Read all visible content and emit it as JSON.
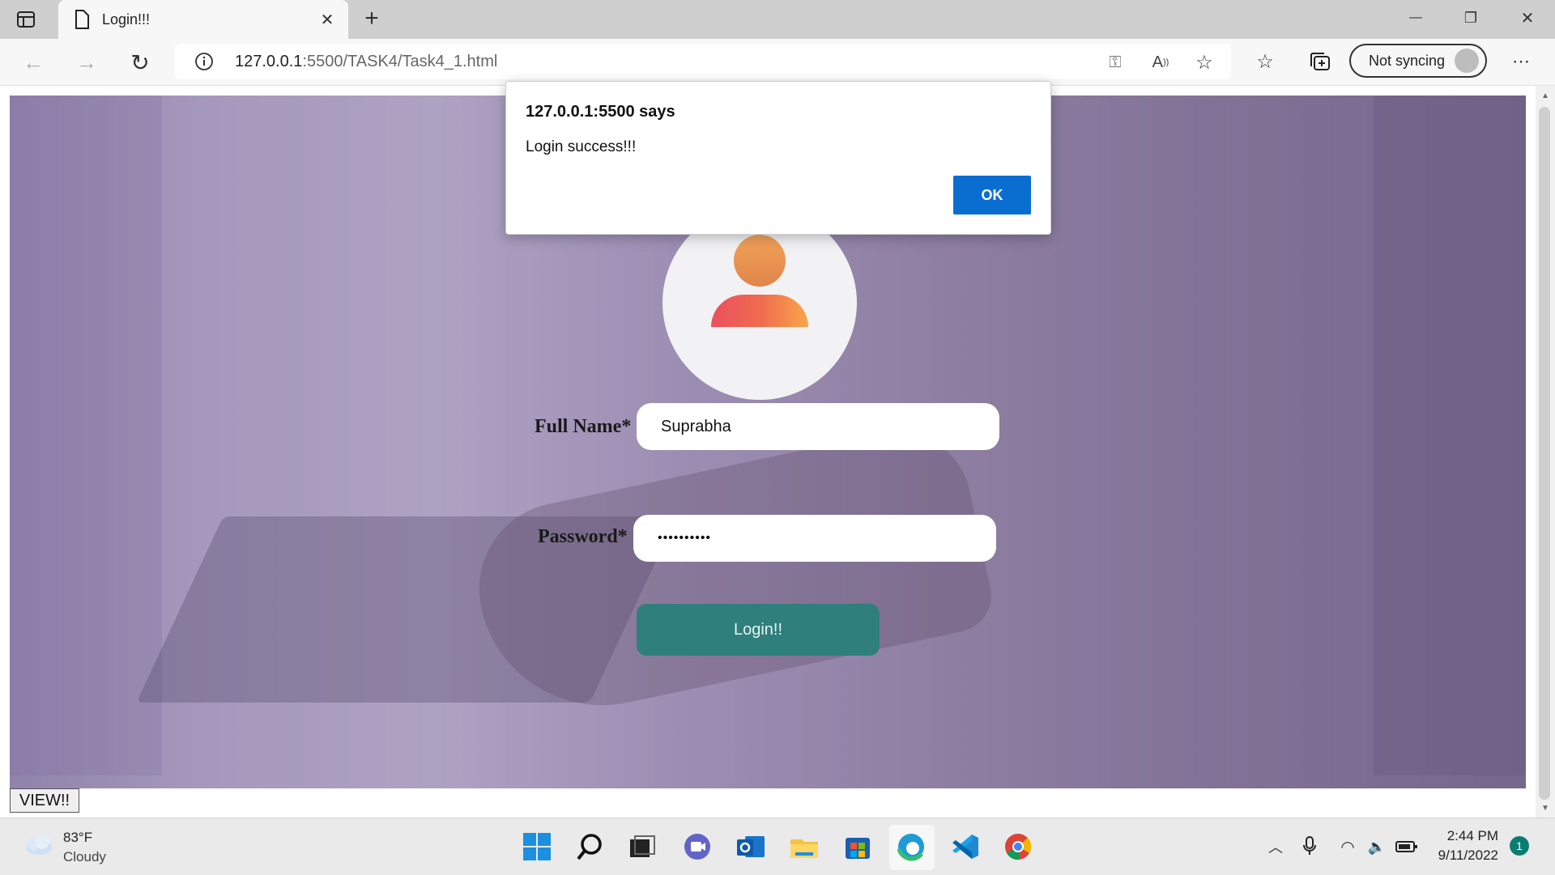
{
  "browser": {
    "tab_title": "Login!!!",
    "url_host": "127.0.0.1",
    "url_rest": ":5500/TASK4/Task4_1.html",
    "sync_label": "Not syncing",
    "icons": [
      "sidebar-icon",
      "page-icon",
      "close-icon",
      "new-tab-icon",
      "back-icon",
      "forward-icon",
      "refresh-icon",
      "info-icon",
      "key-icon",
      "read-aloud-icon",
      "add-favorite-icon",
      "favorites-icon",
      "collections-icon",
      "more-icon"
    ]
  },
  "window": {
    "minimize": "—",
    "restore": "❐",
    "close": "✕"
  },
  "page": {
    "full_name_label": "Full Name*",
    "full_name_value": "Suprabha",
    "password_label": "Password*",
    "password_value": "••••••••••",
    "login_label": "Login!!",
    "view_label": "VIEW!!"
  },
  "dialog": {
    "title": "127.0.0.1:5500 says",
    "message": "Login success!!!",
    "ok_label": "OK"
  },
  "taskbar": {
    "temperature": "83°F",
    "condition": "Cloudy",
    "time": "2:44 PM",
    "date": "9/11/2022",
    "notifications": "1",
    "apps": [
      "start",
      "search",
      "task-view",
      "teams-chat",
      "outlook",
      "file-explorer",
      "store",
      "edge",
      "vscode",
      "chrome"
    ]
  },
  "colors": {
    "accent": "#0a6ed1",
    "login_button": "#2f7f7c"
  }
}
